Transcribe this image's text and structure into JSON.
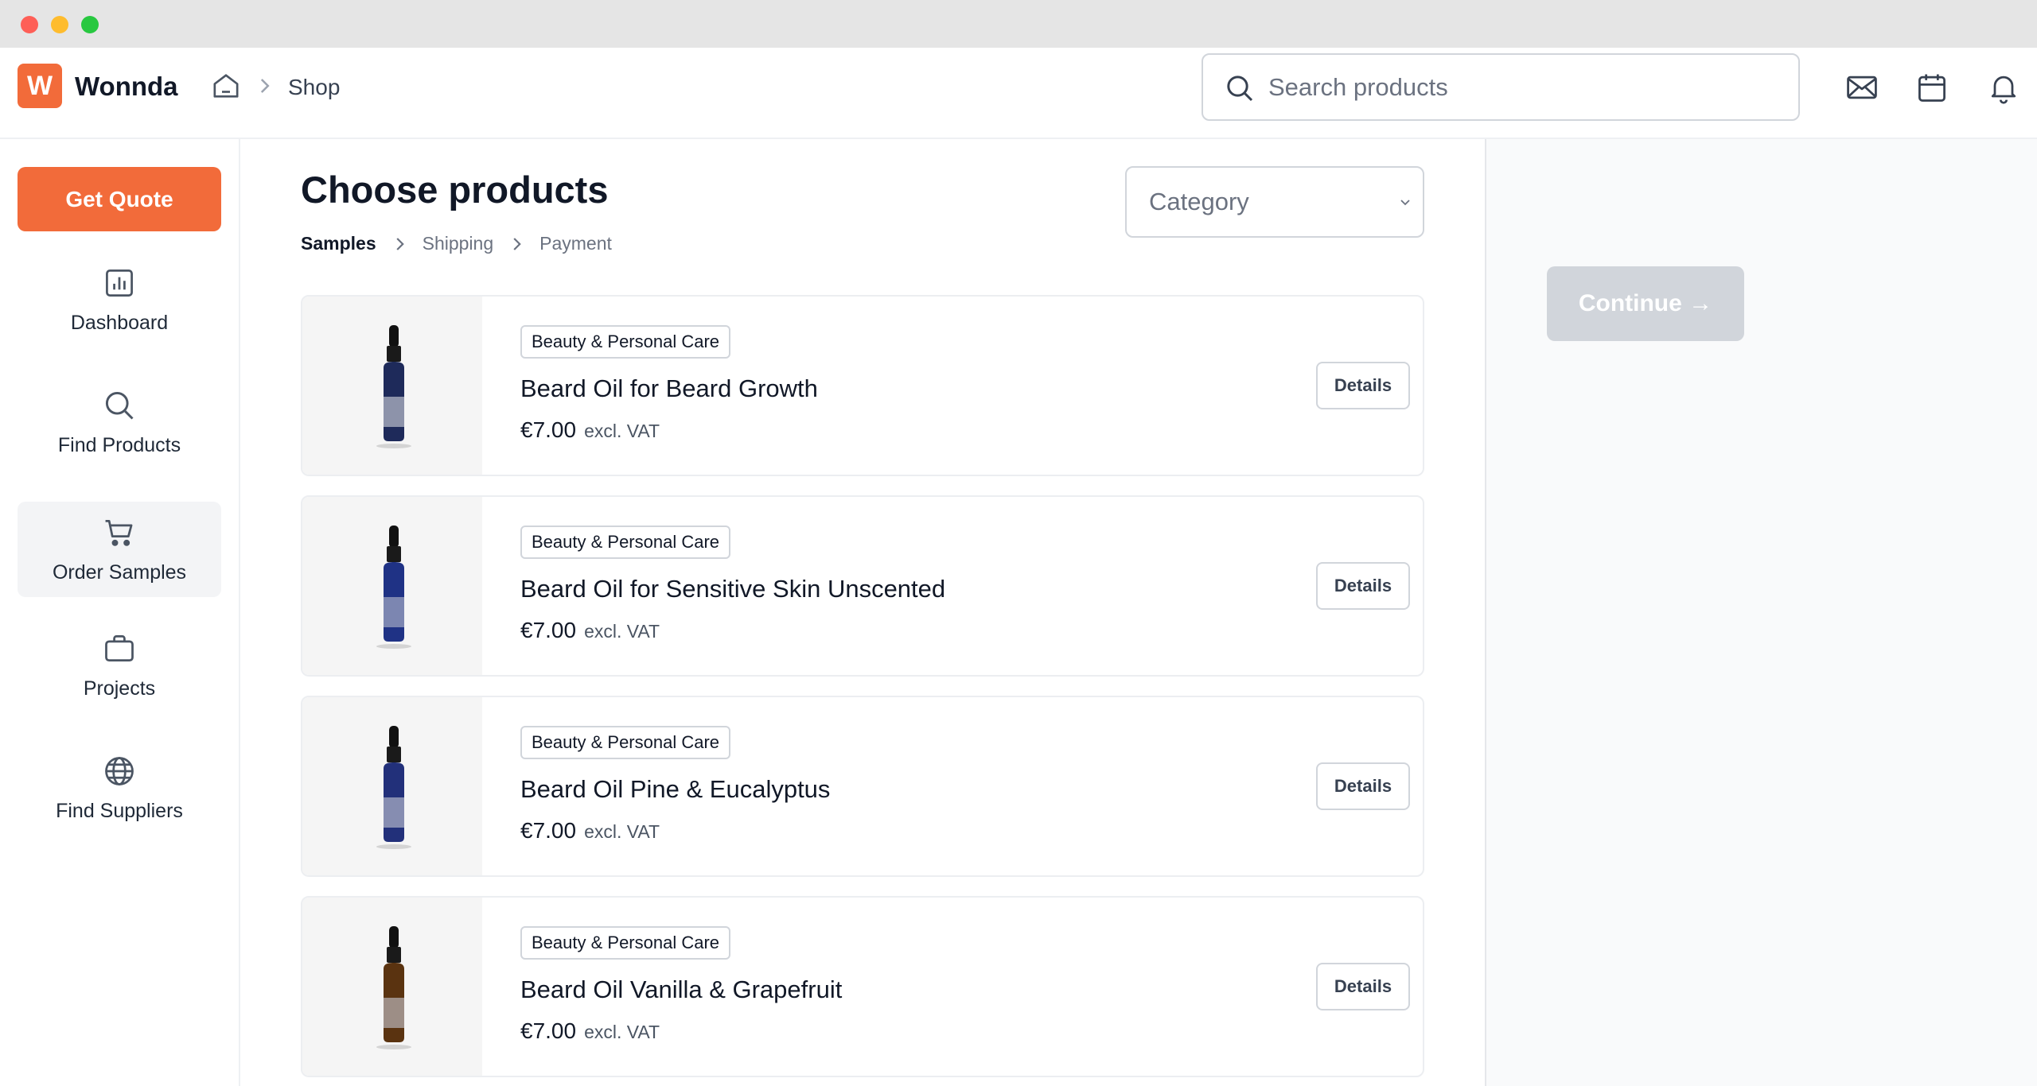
{
  "header": {
    "brand_letter": "W",
    "brand_name": "Wonnda",
    "breadcrumb": {
      "current": "Shop"
    },
    "search": {
      "placeholder": "Search products"
    },
    "icons": [
      "mail-icon",
      "calendar-icon",
      "bell-icon"
    ]
  },
  "sidebar": {
    "quote_button": "Get Quote",
    "items": [
      {
        "label": "Dashboard",
        "icon": "chart-icon",
        "active": false
      },
      {
        "label": "Find Products",
        "icon": "search-icon",
        "active": false
      },
      {
        "label": "Order Samples",
        "icon": "cart-icon",
        "active": true
      },
      {
        "label": "Projects",
        "icon": "briefcase-icon",
        "active": false
      },
      {
        "label": "Find Suppliers",
        "icon": "globe-icon",
        "active": false
      }
    ]
  },
  "main": {
    "title": "Choose products",
    "steps": [
      "Samples",
      "Shipping",
      "Payment"
    ],
    "current_step": "Samples",
    "category_select": {
      "placeholder": "Category"
    },
    "products": [
      {
        "category": "Beauty & Personal Care",
        "name": "Beard Oil for Beard Growth",
        "price": "€7.00",
        "vat_note": "excl. VAT",
        "details_label": "Details",
        "bottle_color": "#1e2a5a"
      },
      {
        "category": "Beauty & Personal Care",
        "name": "Beard Oil for Sensitive Skin Unscented",
        "price": "€7.00",
        "vat_note": "excl. VAT",
        "details_label": "Details",
        "bottle_color": "#1f3285"
      },
      {
        "category": "Beauty & Personal Care",
        "name": "Beard Oil Pine & Eucalyptus",
        "price": "€7.00",
        "vat_note": "excl. VAT",
        "details_label": "Details",
        "bottle_color": "#22307a"
      },
      {
        "category": "Beauty & Personal Care",
        "name": "Beard Oil Vanilla & Grapefruit",
        "price": "€7.00",
        "vat_note": "excl. VAT",
        "details_label": "Details",
        "bottle_color": "#5a3310"
      }
    ]
  },
  "right_panel": {
    "continue_label": "Continue →"
  },
  "colors": {
    "accent": "#f26b3a",
    "active_nav": "#f3f4f6",
    "disabled_button": "#d1d5db"
  }
}
